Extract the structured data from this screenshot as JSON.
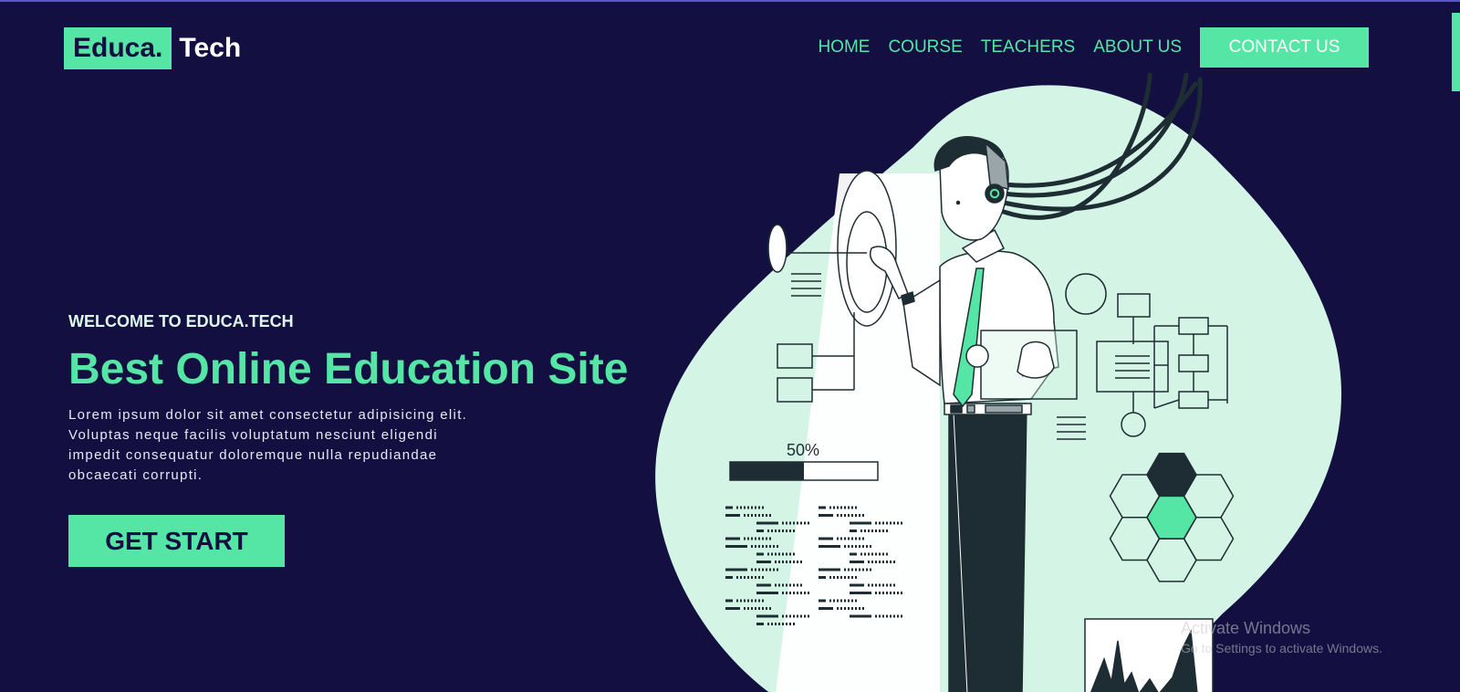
{
  "logo": {
    "highlight": "Educa.",
    "rest": "Tech"
  },
  "nav": {
    "items": [
      "HOME",
      "COURSE",
      "TEACHERS",
      "ABOUT US"
    ],
    "contact_label": "CONTACT US"
  },
  "hero": {
    "welcome": "WELCOME TO EDUCA.TECH",
    "title": "Best Online Education Site",
    "description": "Lorem ipsum dolor sit amet consectetur adipisicing elit. Voluptas neque facilis voluptatum nesciunt eligendi impedit consequatur doloremque nulla repudiandae obcaecati corrupti.",
    "cta_label": "GET START"
  },
  "illustration": {
    "progress_label": "50%",
    "progress_value": 0.5
  },
  "watermark": {
    "title": "Activate Windows",
    "subtitle": "Go to Settings to activate Windows."
  },
  "colors": {
    "background": "#130f40",
    "accent": "#55e6a5",
    "blob": "#d4f5e6",
    "ink": "#1e2d33"
  }
}
